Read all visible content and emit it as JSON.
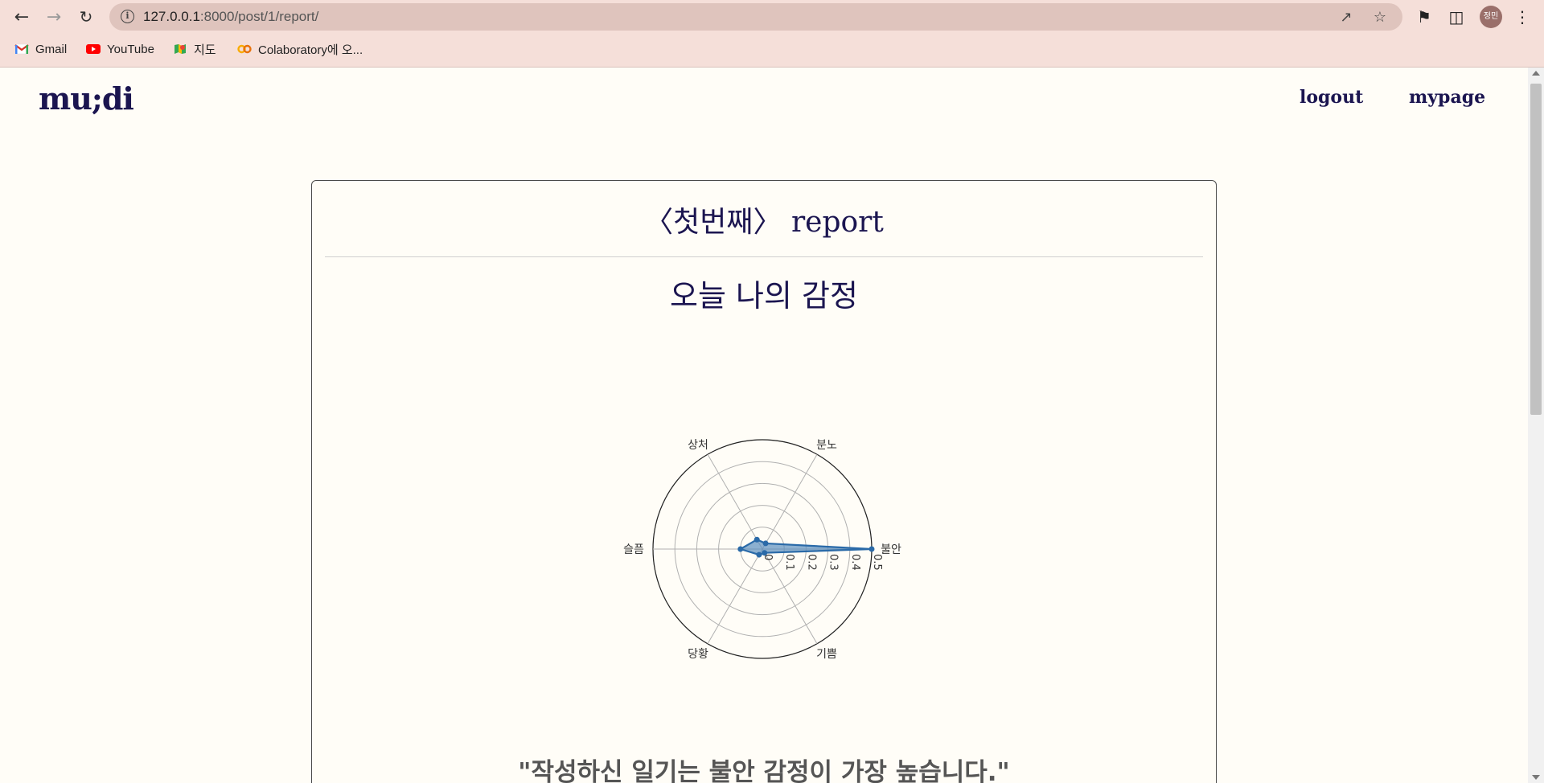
{
  "browser": {
    "url_host": "127.0.0.1",
    "url_path": ":8000/post/1/report/",
    "profile_label": "정민",
    "bookmarks": [
      {
        "label": "Gmail",
        "icon": "gmail-icon"
      },
      {
        "label": "YouTube",
        "icon": "youtube-icon"
      },
      {
        "label": "지도",
        "icon": "maps-icon"
      },
      {
        "label": "Colaboratory에 오...",
        "icon": "colab-icon"
      }
    ]
  },
  "site": {
    "logo": "mu;di",
    "nav": {
      "logout": "logout",
      "mypage": "mypage"
    }
  },
  "report": {
    "title": "〈첫번째〉 report",
    "section_title": "오늘 나의 감정",
    "summary": "\"작성하신 일기는 불안 감정이 가장 높습니다.\""
  },
  "chart_data": {
    "type": "radar",
    "categories": [
      "불안",
      "분노",
      "상처",
      "슬픔",
      "당황",
      "기쁨"
    ],
    "series": [
      {
        "values": [
          0.5,
          0.03,
          0.05,
          0.1,
          0.03,
          0.02
        ]
      }
    ],
    "radial_ticks": [
      "0",
      "0.1",
      "0.2",
      "0.3",
      "0.4",
      "0.5"
    ],
    "rlim": [
      0,
      0.5
    ],
    "grid": true,
    "colors": {
      "fill": "#5b8fbf",
      "line": "#2a6aa8"
    }
  }
}
